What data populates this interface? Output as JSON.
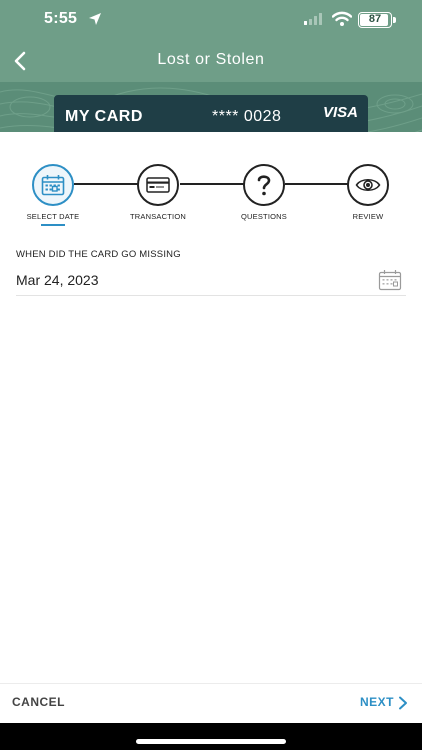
{
  "status_bar": {
    "time": "5:55",
    "battery": "87"
  },
  "nav": {
    "title": "Lost or Stolen"
  },
  "card": {
    "name": "MY CARD",
    "number": "**** 0028",
    "brand": "VISA"
  },
  "steps": [
    {
      "label": "SELECT DATE",
      "icon": "calendar-icon",
      "active": true
    },
    {
      "label": "TRANSACTION",
      "icon": "credit-card-icon",
      "active": false
    },
    {
      "label": "QUESTIONS",
      "icon": "question-icon",
      "active": false
    },
    {
      "label": "REVIEW",
      "icon": "eye-icon",
      "active": false
    }
  ],
  "form": {
    "label": "WHEN DID THE CARD GO MISSING",
    "date_value": "Mar 24, 2023"
  },
  "footer": {
    "cancel_label": "CANCEL",
    "next_label": "NEXT"
  },
  "colors": {
    "header": "#6f9e88",
    "card": "#1f3e46",
    "accent": "#2d8fc5"
  }
}
